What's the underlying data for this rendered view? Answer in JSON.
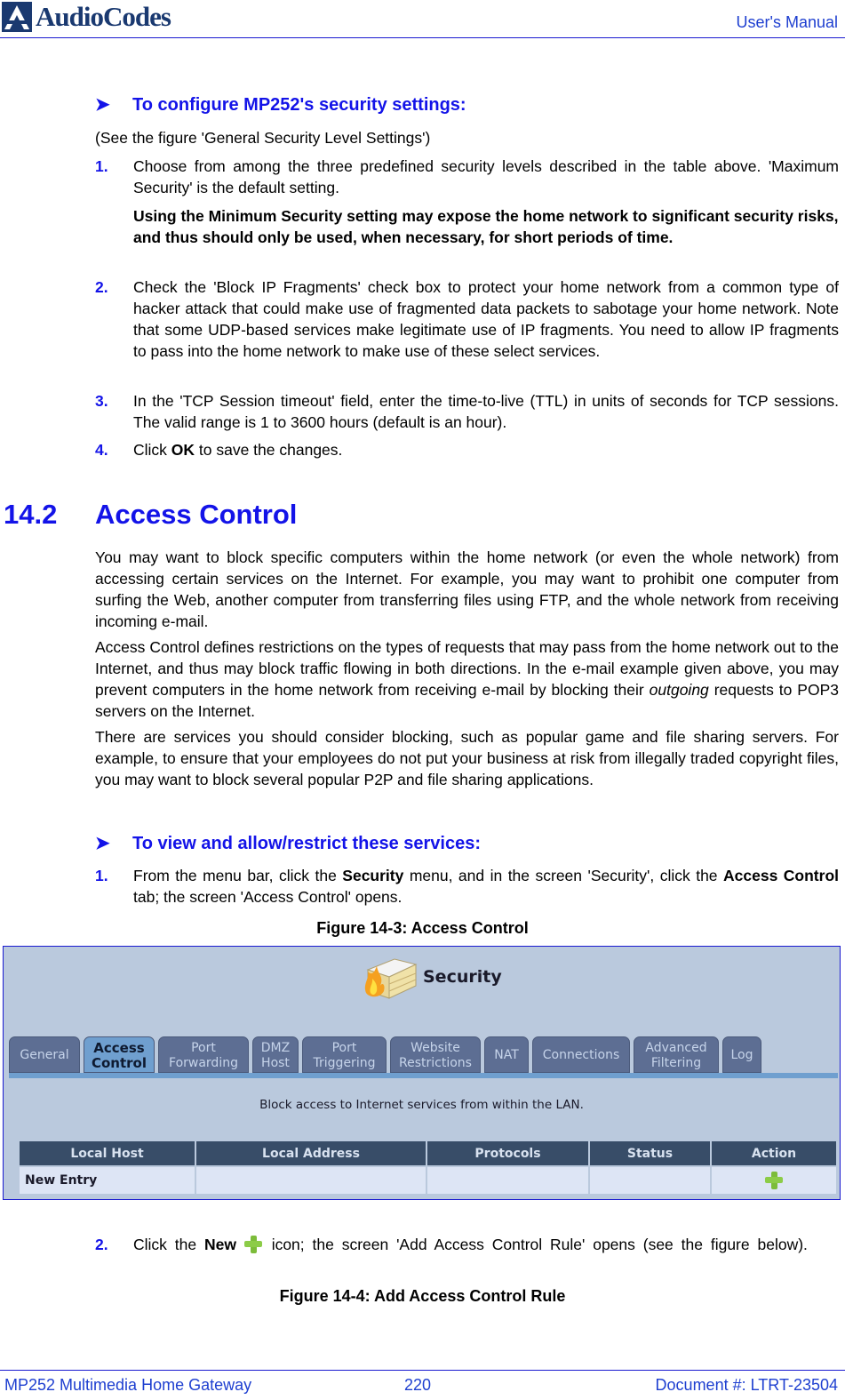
{
  "header": {
    "logo_text": "AudioCodes",
    "title": "User's Manual"
  },
  "procedure1": {
    "heading": "To configure MP252's security settings:",
    "intro": "(See the figure 'General Security Level Settings')",
    "steps": [
      {
        "num": "1.",
        "text": "Choose from among the three predefined security levels described in the table above. 'Maximum Security' is the default setting."
      },
      {
        "num": "2.",
        "text": "Check the 'Block IP Fragments' check box to protect your home network from a common type of hacker attack that could make use of fragmented data packets to sabotage your home network. Note that some UDP-based services make legitimate use of IP fragments. You need to allow IP fragments to pass into the home network to make use of these select services."
      },
      {
        "num": "3.",
        "text": "In the 'TCP Session timeout' field, enter the time-to-live (TTL) in units of seconds for TCP sessions. The valid range is 1 to 3600 hours (default is an hour)."
      },
      {
        "num": "4.",
        "text_before": "Click ",
        "bold": "OK",
        "text_after": " to save the changes."
      }
    ],
    "note": "Using the Minimum Security setting may expose the home network to significant security risks, and thus should only be used, when necessary, for short periods of time."
  },
  "section": {
    "number": "14.2",
    "title": "Access Control",
    "paragraphs": [
      "You may want to block specific computers within the home network (or even the whole network) from accessing certain services on the Internet. For example, you may want to prohibit one computer from surfing the Web, another computer from transferring files using FTP, and the whole network from receiving incoming e-mail.",
      {
        "before": "Access Control defines restrictions on the types of requests that may pass from the home network out to the Internet, and thus may block traffic flowing in both directions. In the e-mail example given above, you may prevent computers in the home network from receiving e-mail by blocking their ",
        "italic": "outgoing",
        "after": " requests to POP3 servers on the Internet."
      },
      "There are services you should consider blocking, such as popular game and file sharing servers. For example, to ensure that your employees do not put your business at risk from illegally traded copyright files, you may want to block several popular P2P and file sharing applications."
    ]
  },
  "procedure2": {
    "heading": "To view and allow/restrict these services:",
    "step1": {
      "num": "1.",
      "t1": "From the menu bar, click the ",
      "b1": "Security",
      "t2": " menu, and in the screen 'Security', click the ",
      "b2": "Access Control",
      "t3": " tab; the screen 'Access Control' opens."
    },
    "step2": {
      "num": "2.",
      "t1": "Click the ",
      "b1": "New",
      "t2": " icon; the screen 'Add Access Control Rule' opens (see the figure below)."
    }
  },
  "figure3": {
    "caption": "Figure 14-3: Access Control",
    "screen_title": "Security",
    "tabs": [
      {
        "label": "General",
        "active": false
      },
      {
        "label": "Access Control",
        "active": true
      },
      {
        "label": "Port Forwarding",
        "active": false
      },
      {
        "label": "DMZ Host",
        "active": false
      },
      {
        "label": "Port Triggering",
        "active": false
      },
      {
        "label": "Website Restrictions",
        "active": false
      },
      {
        "label": "NAT",
        "active": false
      },
      {
        "label": "Connections",
        "active": false
      },
      {
        "label": "Advanced Filtering",
        "active": false
      },
      {
        "label": "Log",
        "active": false
      }
    ],
    "description": "Block access to Internet services from within the LAN.",
    "table": {
      "columns": [
        "Local Host",
        "Local Address",
        "Protocols",
        "Status",
        "Action"
      ],
      "rows": [
        {
          "local_host": "New Entry",
          "local_address": "",
          "protocols": "",
          "status": "",
          "action_icon": "add-icon"
        }
      ]
    }
  },
  "figure4": {
    "caption": "Figure 14-4: Add Access Control Rule"
  },
  "footer": {
    "left": "MP252 Multimedia Home Gateway",
    "center": "220",
    "right": "Document #: LTRT-23504"
  },
  "colors": {
    "heading_blue": "#1313e8",
    "header_blue": "#1e3fd0",
    "logo_navy": "#1a3970",
    "screen_bg": "#bac9dd",
    "table_header": "#384d68"
  }
}
